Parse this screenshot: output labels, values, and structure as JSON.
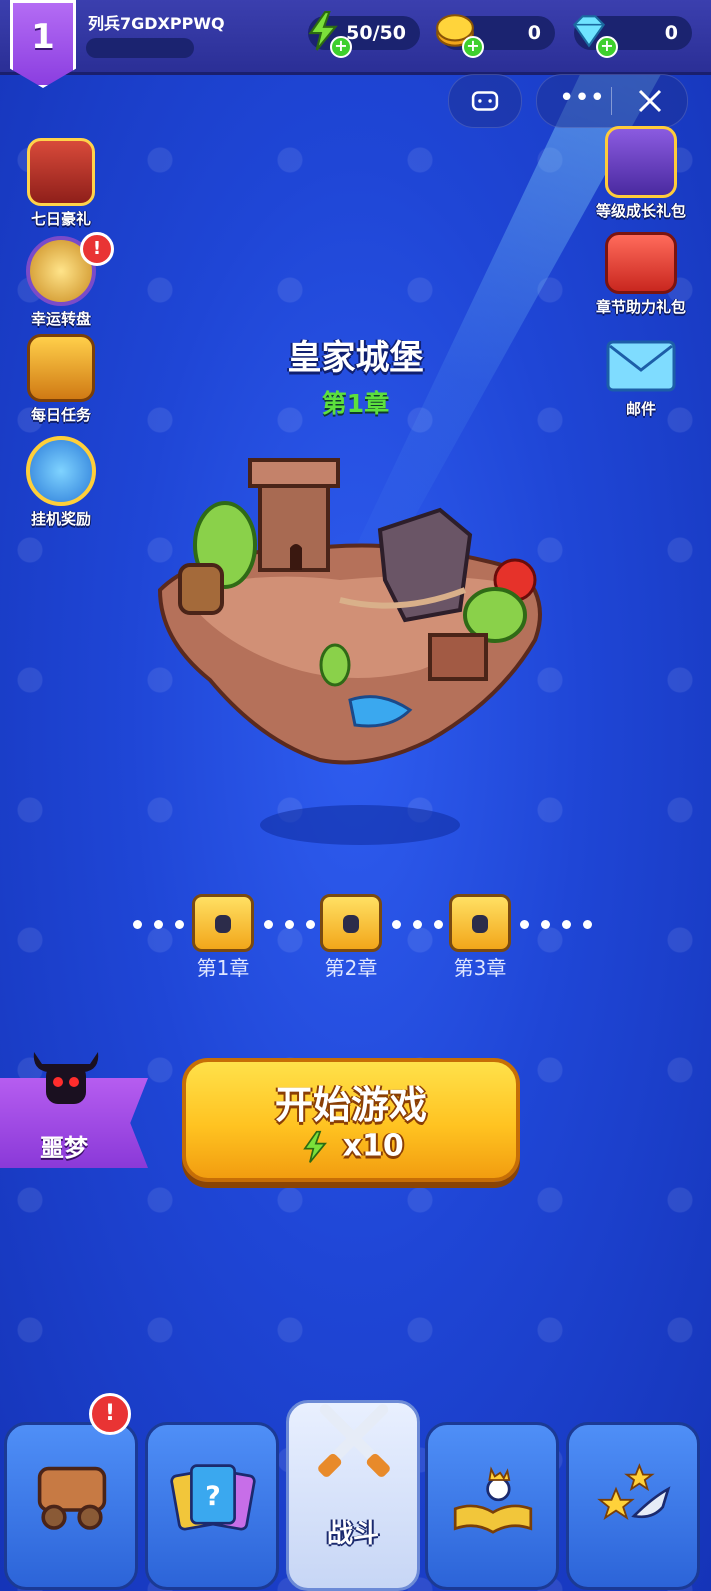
{
  "player": {
    "level": "1",
    "name": "列兵7GDXPPWQ"
  },
  "resources": {
    "energy": "50/50",
    "gold": "0",
    "gems": "0"
  },
  "left_menu": [
    {
      "label": "七日豪礼",
      "icon": "gift-book-icon"
    },
    {
      "label": "幸运转盘",
      "icon": "lucky-wheel-icon",
      "alert": "!"
    },
    {
      "label": "每日任务",
      "icon": "daily-task-icon"
    },
    {
      "label": "挂机奖励",
      "icon": "stopwatch-icon"
    }
  ],
  "right_menu": [
    {
      "label": "等级成长礼包",
      "icon": "level-pack-icon"
    },
    {
      "label": "章节助力礼包",
      "icon": "chapter-pack-icon"
    },
    {
      "label": "邮件",
      "icon": "mail-icon"
    }
  ],
  "stage": {
    "title": "皇家城堡",
    "chapter": "第1章"
  },
  "chapter_chests": [
    {
      "label": "第1章"
    },
    {
      "label": "第2章"
    },
    {
      "label": "第3章"
    }
  ],
  "mode": {
    "label": "噩梦"
  },
  "start_button": {
    "label": "开始游戏",
    "cost": "x10"
  },
  "bottom_nav": [
    {
      "label": "",
      "icon": "cart-icon",
      "alert": "!"
    },
    {
      "label": "",
      "icon": "cards-icon"
    },
    {
      "label": "战斗",
      "icon": "crossed-swords-icon",
      "active": true
    },
    {
      "label": "",
      "icon": "spellbook-icon"
    },
    {
      "label": "",
      "icon": "stars-icon"
    }
  ],
  "colors": {
    "background": "#1f46d6",
    "accent_green": "#5de03d",
    "button_yellow": "#ffc321",
    "alert_red": "#e93434"
  }
}
